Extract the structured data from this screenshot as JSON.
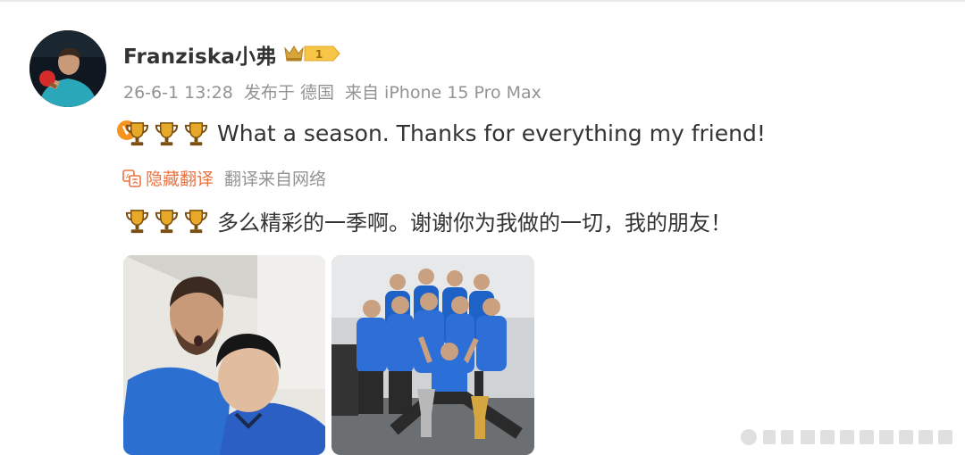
{
  "post": {
    "username": "Franziska小弗",
    "meta": {
      "date": "26-6-1 13:28",
      "location": "发布于 德国",
      "device": "来自 iPhone 15 Pro Max"
    },
    "text": "What a season. Thanks for everything my friend!",
    "translate": {
      "hide_label": "隐藏翻译",
      "source_label": "翻译来自网络"
    },
    "translated_text": "多么精彩的一季啊。谢谢你为我做的一切，我的朋友！",
    "trophy_count": 3,
    "member_badge_level": "1",
    "images_count": 2
  },
  "colors": {
    "accent_orange": "#eb7340",
    "meta_gray": "#939393",
    "text": "#333333",
    "verified_orange": "#f7931e"
  },
  "icons": [
    "verified-icon",
    "vip-crown-icon",
    "trophy-icon",
    "translate-icon"
  ]
}
